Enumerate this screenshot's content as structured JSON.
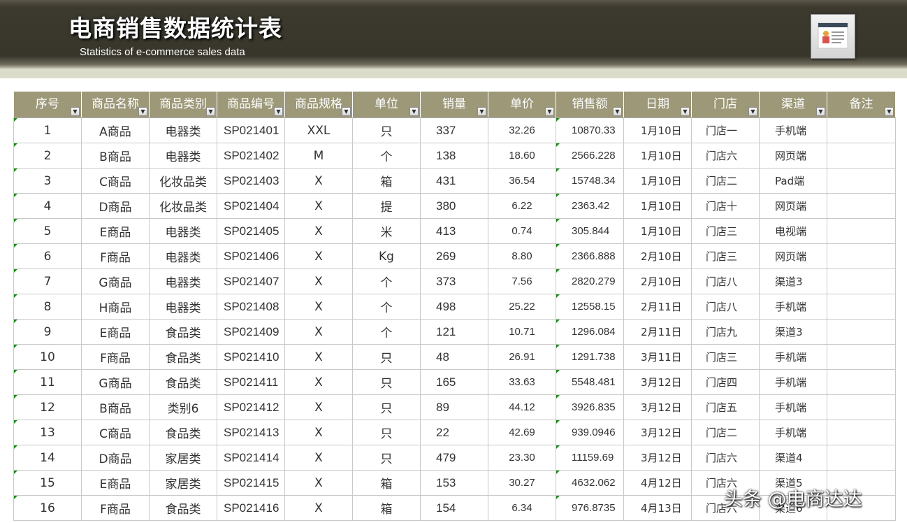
{
  "header": {
    "title": "电商销售数据统计表",
    "subtitle": "Statistics of e-commerce sales data",
    "logo_icon": "report-card-icon"
  },
  "colors": {
    "banner": "#38362b",
    "header_row": "#9c9878",
    "strip": "#dcdccb"
  },
  "table": {
    "columns": [
      "序号",
      "商品名称",
      "商品类别",
      "商品编号",
      "商品规格",
      "单位",
      "销量",
      "单价",
      "销售额",
      "日期",
      "门店",
      "渠道",
      "备注"
    ],
    "rows": [
      [
        "1",
        "A商品",
        "电器类",
        "SP021401",
        "XXL",
        "只",
        "337",
        "32.26",
        "10870.33",
        "1月10日",
        "门店一",
        "手机端",
        ""
      ],
      [
        "2",
        "B商品",
        "电器类",
        "SP021402",
        "M",
        "个",
        "138",
        "18.60",
        "2566.228",
        "1月10日",
        "门店六",
        "网页端",
        ""
      ],
      [
        "3",
        "C商品",
        "化妆品类",
        "SP021403",
        "X",
        "箱",
        "431",
        "36.54",
        "15748.34",
        "1月10日",
        "门店二",
        "Pad端",
        ""
      ],
      [
        "4",
        "D商品",
        "化妆品类",
        "SP021404",
        "X",
        "提",
        "380",
        "6.22",
        "2363.42",
        "1月10日",
        "门店十",
        "网页端",
        ""
      ],
      [
        "5",
        "E商品",
        "电器类",
        "SP021405",
        "X",
        "米",
        "413",
        "0.74",
        "305.844",
        "1月10日",
        "门店三",
        "电视端",
        ""
      ],
      [
        "6",
        "F商品",
        "电器类",
        "SP021406",
        "X",
        "Kg",
        "269",
        "8.80",
        "2366.888",
        "2月10日",
        "门店三",
        "网页端",
        ""
      ],
      [
        "7",
        "G商品",
        "电器类",
        "SP021407",
        "X",
        "个",
        "373",
        "7.56",
        "2820.279",
        "2月10日",
        "门店八",
        "渠道3",
        ""
      ],
      [
        "8",
        "H商品",
        "电器类",
        "SP021408",
        "X",
        "个",
        "498",
        "25.22",
        "12558.15",
        "2月11日",
        "门店八",
        "手机端",
        ""
      ],
      [
        "9",
        "E商品",
        "食品类",
        "SP021409",
        "X",
        "个",
        "121",
        "10.71",
        "1296.084",
        "2月11日",
        "门店九",
        "渠道3",
        ""
      ],
      [
        "10",
        "F商品",
        "食品类",
        "SP021410",
        "X",
        "只",
        "48",
        "26.91",
        "1291.738",
        "3月11日",
        "门店三",
        "手机端",
        ""
      ],
      [
        "11",
        "G商品",
        "食品类",
        "SP021411",
        "X",
        "只",
        "165",
        "33.63",
        "5548.481",
        "3月12日",
        "门店四",
        "手机端",
        ""
      ],
      [
        "12",
        "B商品",
        "类别6",
        "SP021412",
        "X",
        "只",
        "89",
        "44.12",
        "3926.835",
        "3月12日",
        "门店五",
        "手机端",
        ""
      ],
      [
        "13",
        "C商品",
        "食品类",
        "SP021413",
        "X",
        "只",
        "22",
        "42.69",
        "939.0946",
        "3月12日",
        "门店二",
        "手机端",
        ""
      ],
      [
        "14",
        "D商品",
        "家居类",
        "SP021414",
        "X",
        "只",
        "479",
        "23.30",
        "11159.69",
        "3月12日",
        "门店六",
        "渠道4",
        ""
      ],
      [
        "15",
        "E商品",
        "家居类",
        "SP021415",
        "X",
        "箱",
        "153",
        "30.27",
        "4632.062",
        "4月12日",
        "门店六",
        "渠道5",
        ""
      ],
      [
        "16",
        "F商品",
        "食品类",
        "SP021416",
        "X",
        "箱",
        "154",
        "6.34",
        "976.8735",
        "4月13日",
        "门店六",
        "渠道6",
        ""
      ]
    ]
  },
  "watermark": "头条 @电商达达"
}
